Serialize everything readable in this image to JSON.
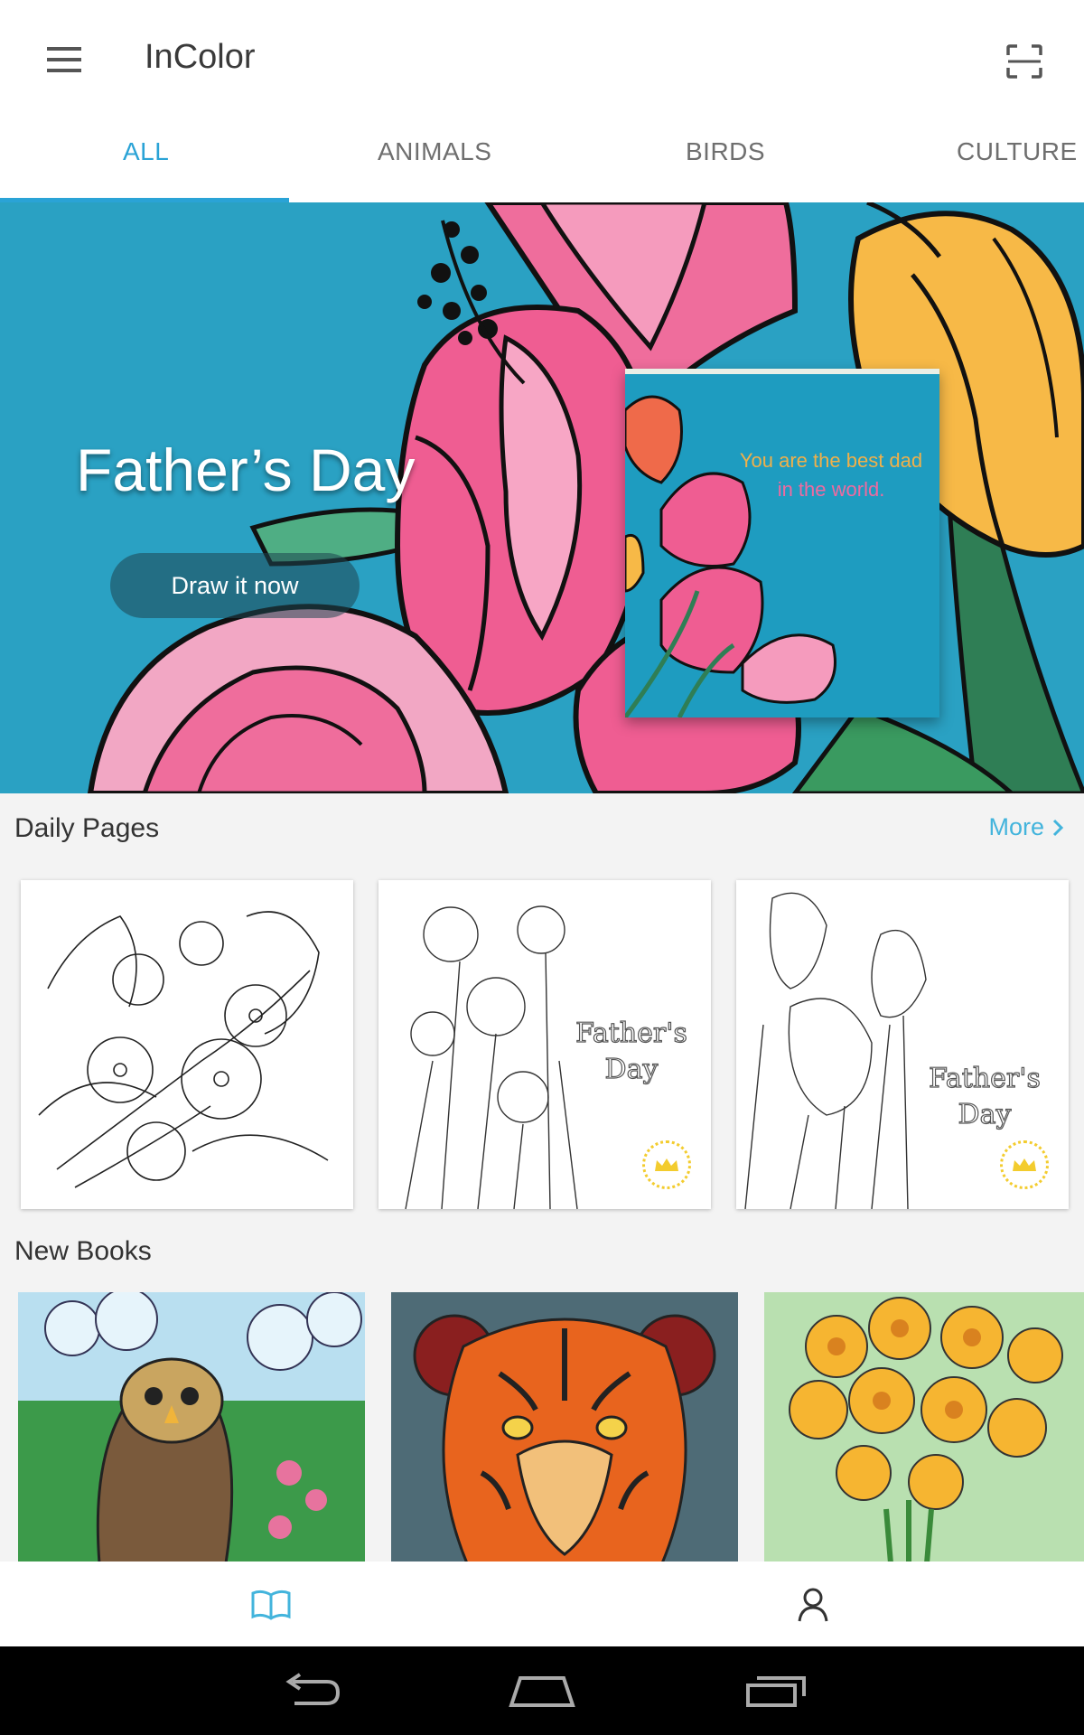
{
  "app": {
    "title": "InColor"
  },
  "tabs": [
    {
      "label": "ALL",
      "active": true
    },
    {
      "label": "ANIMALS",
      "active": false
    },
    {
      "label": "BIRDS",
      "active": false
    },
    {
      "label": "CULTURE",
      "active": false
    }
  ],
  "hero": {
    "title": "Father’s Day",
    "button_label": "Draw it now",
    "card_line1": "You are the best dad",
    "card_line2": "in the world."
  },
  "daily": {
    "title": "Daily Pages",
    "more_label": "More",
    "cards": [
      {
        "name": "flowers-page",
        "premium": false
      },
      {
        "name": "daffodils-fathers-day-page",
        "text1": "Father's",
        "text2": "Day",
        "premium": true
      },
      {
        "name": "irises-fathers-day-page",
        "text1": "Father's",
        "text2": "Day",
        "premium": true
      }
    ]
  },
  "books": {
    "title": "New Books",
    "items": [
      {
        "name": "owl-book"
      },
      {
        "name": "tiger-book"
      },
      {
        "name": "daffodils-book"
      }
    ]
  },
  "bottom_nav": [
    {
      "icon": "book-icon",
      "active": true
    },
    {
      "icon": "profile-icon",
      "active": false
    }
  ],
  "colors": {
    "accent": "#2aa3d6",
    "link": "#43b4dc",
    "hero_bg": "#2aa1c3",
    "premium": "#f3cc2e"
  }
}
